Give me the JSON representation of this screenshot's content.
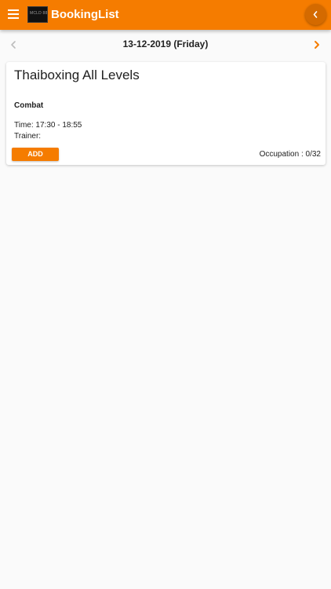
{
  "app_bar": {
    "title": "BookingList",
    "logo_text": "MCLD 88",
    "background_color": "#f57c00",
    "back_button_color": "#d46a00",
    "icons": {
      "menu": "menu-icon",
      "back": "chevron-left-icon"
    }
  },
  "date_nav": {
    "date_label": "13-12-2019 (Friday)",
    "prev_icon": "chevron-left-icon",
    "prev_color": "#bdbdbd",
    "next_icon": "chevron-right-icon",
    "next_color": "#f57c00"
  },
  "classes": [
    {
      "title": "Thaiboxing All Levels",
      "category": "Combat",
      "time_label": "Time:",
      "time_value": "17:30 - 18:55",
      "trainer_label": "Trainer:",
      "trainer_value": "",
      "add_label": "ADD",
      "occupation_label": "Occupation :",
      "occupation_value": "0/32"
    }
  ]
}
